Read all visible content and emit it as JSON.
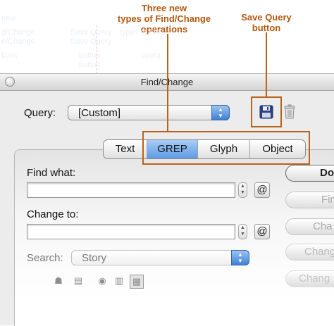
{
  "annotations": {
    "three_new_types": "Three new\ntypes of Find/Change\noperations",
    "save_query_button": "Save Query\nbutton"
  },
  "ghost_text": [
    "new",
    "d/Change",
    "e/Change",
    "lions",
    "Save Query",
    "Save Query",
    "types of Fin",
    "button",
    "button",
    "opera"
  ],
  "window": {
    "title": "Find/Change"
  },
  "query": {
    "label": "Query:",
    "value": "[Custom]"
  },
  "tabs": [
    {
      "label": "Text",
      "selected": false
    },
    {
      "label": "GREP",
      "selected": true
    },
    {
      "label": "Glyph",
      "selected": false
    },
    {
      "label": "Object",
      "selected": false
    }
  ],
  "find": {
    "label": "Find what:",
    "value": "",
    "special_char_button": "@"
  },
  "change": {
    "label": "Change to:",
    "value": "",
    "special_char_button": "@"
  },
  "search": {
    "label": "Search:",
    "value": "Story"
  },
  "buttons": {
    "done": "Do",
    "find": "Fin",
    "change": "Cha",
    "change_all": "Chang",
    "change_find": "Chang"
  },
  "icons": {
    "save_query": "floppy-disk-icon",
    "delete_query": "trash-icon"
  },
  "colors": {
    "callout": "#b5570f",
    "selected_tab": "#5d9ae4",
    "popup_arrows": "#3d80d8"
  }
}
